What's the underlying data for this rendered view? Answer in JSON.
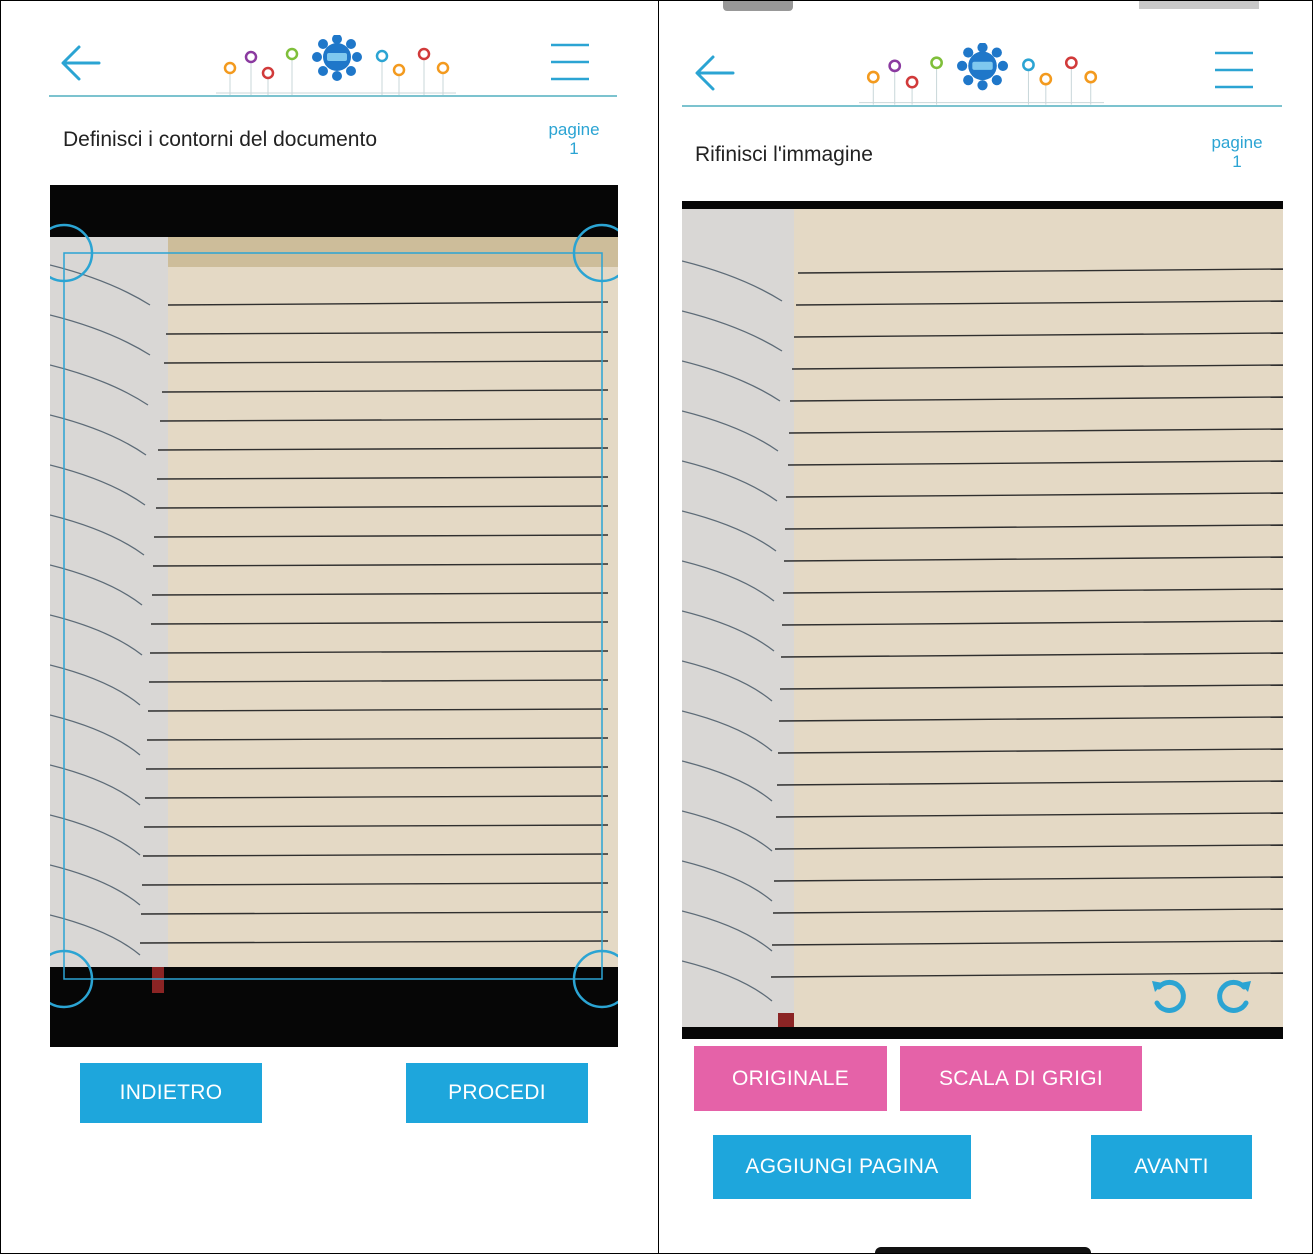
{
  "left": {
    "title": "Definisci i contorni del documento",
    "pages_label": "pagine",
    "pages_count": "1",
    "buttons": {
      "back": "INDIETRO",
      "proceed": "PROCEDI"
    }
  },
  "right": {
    "title": "Rifinisci l'immagine",
    "pages_label": "pagine",
    "pages_count": "1",
    "filter_buttons": {
      "original": "ORIGINALE",
      "grayscale": "SCALA DI GRIGI"
    },
    "buttons": {
      "add_page": "AGGIUNGI PAGINA",
      "next": "AVANTI"
    }
  },
  "icons": {
    "back": "back-arrow-icon",
    "menu": "hamburger-menu-icon",
    "logo": "flower-logo-icon",
    "rotate_left": "rotate-left-icon",
    "rotate_right": "rotate-right-icon"
  },
  "colors": {
    "accent_blue": "#1ea6dc",
    "accent_pink": "#e562a8",
    "divider": "#7cc3cf",
    "paper": "#e6dcc9"
  }
}
